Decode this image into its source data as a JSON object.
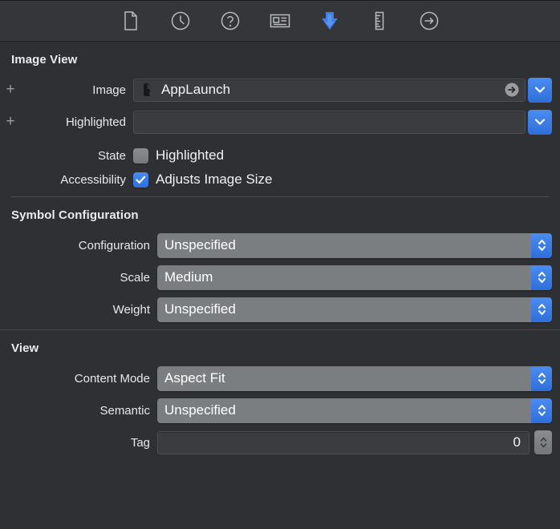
{
  "toolbar": {
    "icons": [
      {
        "name": "file-inspector-icon",
        "glyph": "document",
        "active": false
      },
      {
        "name": "history-inspector-icon",
        "glyph": "clock",
        "active": false
      },
      {
        "name": "help-inspector-icon",
        "glyph": "question",
        "active": false
      },
      {
        "name": "identity-inspector-icon",
        "glyph": "idcard",
        "active": false
      },
      {
        "name": "attributes-inspector-icon",
        "glyph": "arrowdown",
        "active": true
      },
      {
        "name": "size-inspector-icon",
        "glyph": "ruler",
        "active": false
      },
      {
        "name": "connections-inspector-icon",
        "glyph": "arrowcircle",
        "active": false
      }
    ]
  },
  "image_view_section": {
    "title": "Image View",
    "image_row": {
      "label": "Image",
      "value": "AppLaunch",
      "add_button": "+",
      "thumbnail_icon": "app-launch-thumbnail-icon",
      "reveal_icon": "arrow-right-circle-icon",
      "dropdown_icon": "chevron-down-icon"
    },
    "highlighted_row": {
      "label": "Highlighted",
      "value": "",
      "add_button": "+",
      "dropdown_icon": "chevron-down-icon"
    },
    "state_row": {
      "label": "State",
      "checkbox_label": "Highlighted",
      "checked": false
    },
    "accessibility_row": {
      "label": "Accessibility",
      "checkbox_label": "Adjusts Image Size",
      "checked": true
    }
  },
  "symbol_configuration_section": {
    "title": "Symbol Configuration",
    "rows": [
      {
        "label": "Configuration",
        "value": "Unspecified"
      },
      {
        "label": "Scale",
        "value": "Medium"
      },
      {
        "label": "Weight",
        "value": "Unspecified"
      }
    ]
  },
  "view_section": {
    "title": "View",
    "content_mode_row": {
      "label": "Content Mode",
      "value": "Aspect Fit"
    },
    "semantic_row": {
      "label": "Semantic",
      "value": "Unspecified"
    },
    "tag_row": {
      "label": "Tag",
      "value": "0"
    }
  },
  "colors": {
    "window_background": "#2e3033",
    "toolbar_background": "#343639",
    "accent_blue": "#3f7fec",
    "select_gray": "#7b7e81",
    "text_primary": "#f2f4f6",
    "divider": "#4a4d50"
  }
}
